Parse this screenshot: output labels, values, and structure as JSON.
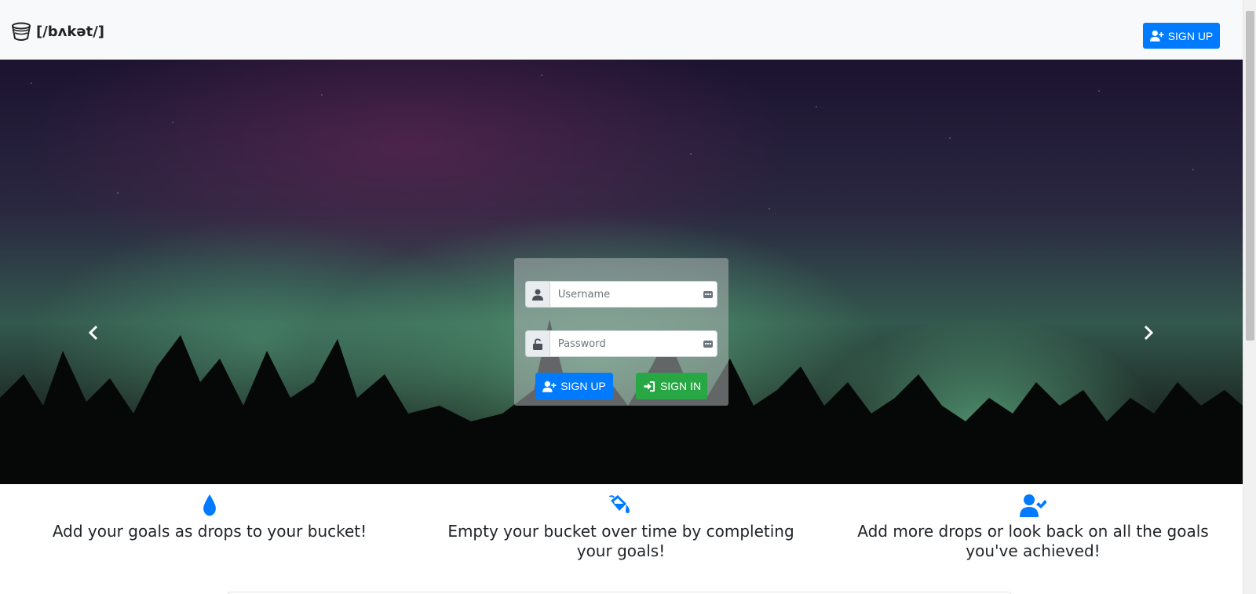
{
  "brand": {
    "name": "[/bʌkət/]",
    "icon": "bucket-icon"
  },
  "navbar": {
    "signup_label": "SIGN UP",
    "signup_icon": "user-plus-icon"
  },
  "login": {
    "username_placeholder": "Username",
    "password_placeholder": "Password",
    "username_icon": "user-icon",
    "password_icon": "lock-icon",
    "signup_label": "SIGN UP",
    "signin_label": "SIGN IN",
    "signin_icon": "sign-in-icon"
  },
  "carousel": {
    "prev_icon": "chevron-left-icon",
    "next_icon": "chevron-right-icon"
  },
  "features": [
    {
      "icon": "droplet-icon",
      "text": "Add your goals as drops to your bucket!"
    },
    {
      "icon": "fill-drip-icon",
      "text": "Empty your bucket over time by completing your goals!"
    },
    {
      "icon": "user-check-icon",
      "text": "Add more drops or look back on all the goals you've achieved!"
    }
  ],
  "colors": {
    "primary": "#007bff",
    "success": "#28a745",
    "navbar_bg": "#f8f9fa"
  }
}
